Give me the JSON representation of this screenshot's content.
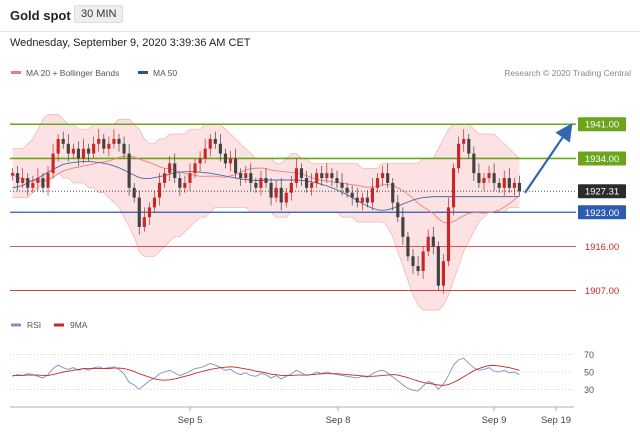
{
  "header": {
    "title": "Gold spot",
    "timeframe": "30 MIN"
  },
  "datetime": "Wednesday, September 9, 2020 3:39:36 AM CET",
  "legend": {
    "ma20_label": "MA 20 + Bollinger Bands",
    "ma50_label": "MA 50",
    "copyright": "Research © 2020 Trading Central"
  },
  "colors": {
    "up": "#c62828",
    "down": "#424242",
    "bb_fill": "#fbd8d8",
    "bb_line": "#f3a6a6",
    "ma20": "#f08080",
    "ma50": "#4a6aa8",
    "resistance": "#6aa51c",
    "support_blue": "#2a5cb0",
    "support_red": "#c62828",
    "arrow": "#3465b0",
    "rsi": "#7a93c4",
    "rsi_ma": "#c62828"
  },
  "chart_data": [
    {
      "type": "candlestick",
      "instrument": "Gold spot",
      "timeframe": "30 MIN",
      "ylim": [
        1902,
        1948
      ],
      "x_tick_labels": [
        "Sep 5",
        "Sep 8",
        "Sep 9",
        "Sep 19"
      ],
      "levels": [
        {
          "value": 1941.0,
          "label": "1941.00",
          "kind": "resistance"
        },
        {
          "value": 1934.0,
          "label": "1934.00",
          "kind": "resistance"
        },
        {
          "value": 1923.0,
          "label": "1923.00",
          "kind": "pivot"
        },
        {
          "value": 1916.0,
          "label": "1916.00",
          "kind": "support"
        },
        {
          "value": 1907.0,
          "label": "1907.00",
          "kind": "support"
        }
      ],
      "last_price": {
        "value": 1927.31,
        "label": "1927.31"
      },
      "forecast_arrow": {
        "from": 1927.0,
        "to": 1940.5
      },
      "close": [
        1931,
        1929,
        1930,
        1928,
        1929,
        1930,
        1928,
        1931,
        1935,
        1938,
        1937,
        1935,
        1936,
        1934,
        1936,
        1935,
        1937,
        1938,
        1936,
        1937,
        1938,
        1937,
        1935,
        1928,
        1926,
        1920,
        1922,
        1924,
        1926,
        1929,
        1931,
        1933,
        1930,
        1928,
        1929,
        1931,
        1933,
        1934,
        1936,
        1938,
        1937,
        1935,
        1933,
        1934,
        1931,
        1930,
        1931,
        1929,
        1928,
        1930,
        1929,
        1926,
        1928,
        1925,
        1927,
        1929,
        1932,
        1930,
        1928,
        1929,
        1931,
        1930,
        1931,
        1930,
        1929,
        1928,
        1927,
        1926,
        1925,
        1926,
        1925,
        1928,
        1930,
        1931,
        1929,
        1925,
        1922,
        1918,
        1914,
        1912,
        1911,
        1915,
        1918,
        1916,
        1908,
        1913,
        1924,
        1932,
        1937,
        1938,
        1935,
        1931,
        1929,
        1930,
        1931,
        1929,
        1928,
        1930,
        1928,
        1929,
        1927.3
      ],
      "ma50": [
        1928.0,
        1928.2,
        1928.5,
        1929.0,
        1929.5,
        1930.0,
        1930.6,
        1931.2,
        1931.8,
        1932.3,
        1932.8,
        1933.0,
        1933.2,
        1933.3,
        1933.4,
        1933.4,
        1933.3,
        1933.2,
        1933.0,
        1932.8,
        1932.5,
        1932.1,
        1931.6,
        1931.1,
        1930.6,
        1930.1,
        1929.9,
        1929.9,
        1930.1,
        1930.3,
        1930.5,
        1930.8,
        1931.0,
        1931.2,
        1931.3,
        1931.3,
        1931.3,
        1931.2,
        1931.1,
        1931.0,
        1930.8,
        1930.6,
        1930.4,
        1930.2,
        1930.0,
        1929.8,
        1929.7,
        1929.6,
        1929.5,
        1929.5,
        1929.6,
        1929.6,
        1929.6,
        1929.6,
        1929.6,
        1929.6,
        1929.6,
        1929.5,
        1929.4,
        1929.2,
        1929.0,
        1928.7,
        1928.4,
        1928.0,
        1927.6,
        1927.1,
        1926.6,
        1926.0,
        1925.4,
        1924.8,
        1924.3,
        1923.8,
        1923.5,
        1923.4,
        1923.5,
        1923.8,
        1924.2,
        1924.7,
        1925.1,
        1925.5,
        1925.8,
        1926.0,
        1926.1,
        1926.2,
        1926.2,
        1926.2,
        1926.2,
        1926.2,
        1926.2,
        1926.2,
        1926.2,
        1926.2,
        1926.2,
        1926.2,
        1926.2,
        1926.2,
        1926.2,
        1926.2,
        1926.2,
        1926.2,
        1926.2
      ],
      "bb_upper": [
        1936,
        1936,
        1936,
        1937,
        1938,
        1940,
        1942,
        1943,
        1943,
        1943,
        1942,
        1941,
        1941,
        1940,
        1940,
        1940,
        1941,
        1941,
        1941,
        1941,
        1941,
        1942,
        1942,
        1942,
        1941,
        1940,
        1938,
        1937,
        1937,
        1938,
        1938,
        1939,
        1939,
        1939,
        1939,
        1940,
        1940,
        1940,
        1941,
        1941,
        1941,
        1941,
        1940,
        1939,
        1938,
        1937,
        1936,
        1935,
        1934,
        1934,
        1934,
        1934,
        1933,
        1933,
        1934,
        1935,
        1935,
        1934,
        1934,
        1933,
        1933,
        1933,
        1933,
        1933,
        1933,
        1933,
        1933,
        1933,
        1933,
        1932,
        1932,
        1932,
        1932,
        1933,
        1933,
        1933,
        1933,
        1933,
        1933,
        1933,
        1933,
        1934,
        1934,
        1934,
        1936,
        1938,
        1940,
        1941,
        1941,
        1941,
        1941,
        1940,
        1939,
        1939,
        1939,
        1939,
        1938,
        1937,
        1936,
        1935,
        1934
      ],
      "bb_lower": [
        1926,
        1926,
        1926,
        1926,
        1927,
        1928,
        1929,
        1930,
        1930,
        1931,
        1930,
        1930,
        1929,
        1929,
        1929,
        1928,
        1928,
        1927,
        1927,
        1926,
        1925,
        1924,
        1922,
        1920,
        1918,
        1915,
        1914,
        1914,
        1914,
        1915,
        1916,
        1917,
        1918,
        1918,
        1919,
        1920,
        1921,
        1922,
        1922,
        1923,
        1924,
        1924,
        1924,
        1924,
        1924,
        1924,
        1924,
        1923,
        1923,
        1923,
        1923,
        1923,
        1922,
        1922,
        1922,
        1923,
        1923,
        1923,
        1923,
        1923,
        1923,
        1923,
        1923,
        1923,
        1923,
        1922,
        1922,
        1922,
        1921,
        1921,
        1921,
        1921,
        1921,
        1921,
        1920,
        1918,
        1915,
        1912,
        1909,
        1906,
        1904,
        1903,
        1903,
        1903,
        1903,
        1904,
        1906,
        1909,
        1912,
        1915,
        1917,
        1919,
        1921,
        1922,
        1923,
        1923,
        1923,
        1923,
        1924,
        1924,
        1924
      ]
    },
    {
      "type": "line",
      "title": "RSI",
      "legend": [
        "RSI",
        "9MA"
      ],
      "ylim": [
        20,
        80
      ],
      "y_ticks": [
        70,
        50,
        30
      ],
      "series": [
        {
          "name": "RSI",
          "values": [
            45,
            47,
            46,
            48,
            47,
            45,
            43,
            47,
            54,
            58,
            55,
            53,
            55,
            52,
            54,
            52,
            55,
            56,
            54,
            55,
            56,
            53,
            48,
            38,
            35,
            30,
            35,
            40,
            43,
            48,
            50,
            52,
            49,
            46,
            48,
            51,
            54,
            55,
            57,
            60,
            58,
            55,
            52,
            53,
            49,
            47,
            49,
            46,
            45,
            48,
            47,
            43,
            46,
            42,
            45,
            48,
            52,
            49,
            46,
            47,
            50,
            48,
            50,
            48,
            47,
            46,
            45,
            44,
            43,
            45,
            44,
            48,
            51,
            52,
            49,
            44,
            40,
            35,
            31,
            29,
            28,
            34,
            39,
            37,
            30,
            36,
            46,
            58,
            64,
            66,
            60,
            55,
            52,
            53,
            55,
            51,
            50,
            52,
            49,
            50,
            47
          ]
        },
        {
          "name": "9MA",
          "values": [
            46,
            46,
            46,
            46.5,
            46.5,
            46.5,
            46,
            46,
            47,
            48.5,
            50,
            51,
            52,
            53,
            54,
            54,
            54,
            54,
            54,
            54,
            54.5,
            54.5,
            54,
            52.5,
            50.5,
            48,
            46,
            44,
            42,
            41,
            40.5,
            41,
            42,
            43.5,
            45,
            46.5,
            48.5,
            50,
            51.5,
            53,
            54,
            55,
            55.5,
            56,
            55.5,
            54.5,
            53.5,
            52.5,
            51,
            50,
            49,
            47.5,
            47,
            46,
            46,
            46,
            46.5,
            46.5,
            46.5,
            47,
            47.5,
            48,
            48,
            48,
            48,
            47.5,
            47,
            46.5,
            46,
            45.5,
            45,
            45,
            45.5,
            46,
            46.5,
            47,
            46.5,
            45,
            43.5,
            41.5,
            39.5,
            38,
            37,
            36,
            35,
            34.5,
            35.5,
            38,
            41,
            44.5,
            48,
            51.5,
            54,
            56,
            57.5,
            57.5,
            57,
            56,
            55,
            53.5,
            52
          ]
        }
      ]
    }
  ]
}
